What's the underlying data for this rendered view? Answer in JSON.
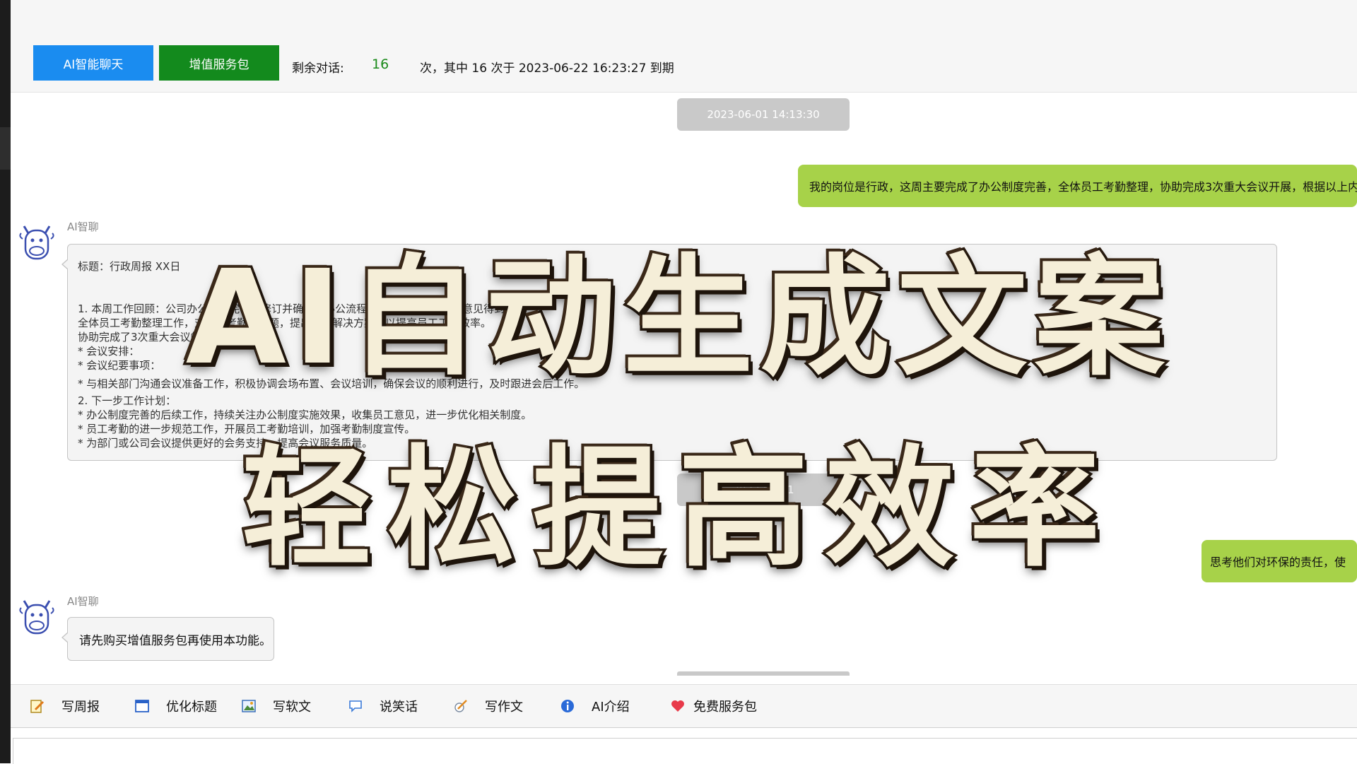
{
  "topbar": {
    "ai_chat_button": "AI智能聊天",
    "vip_button": "增值服务包",
    "remain_label": "剩余对话:",
    "remain_count": "16",
    "remain_detail": "次，其中 16 次于 2023-06-22 16:23:27 到期"
  },
  "chat": {
    "timestamp_1": "2023-06-01 14:13:30",
    "user_message_1": "我的岗位是行政，这周主要完成了办公制度完善，全体员工考勤整理，协助完成3次重大会议开展，根据以上内",
    "ai_name": "AI智聊",
    "ai_reply_1": {
      "lines": [
        "标题：行政周报 XX日",
        "1. 本周工作回顾：公司办公制度完善，修订并确定了办公流程，完成情况以及员工意见得到了，",
        "  全体员工考勤整理工作，对员工考勤的问题，提出相应解决方案，以提高员工工作效率。",
        "  协助完成了3次重大会议的筹备及会务工作。",
        "* 会议安排：",
        "* 会议纪要事项：",
        "* 与相关部门沟通会议准备工作，积极协调会场布置、会议培训，确保会议的顺利进行，及时跟进会后工作。",
        "2. 下一步工作计划：",
        "* 办公制度完善的后续工作，持续关注办公制度实施效果，收集员工意见，进一步优化相关制度。",
        "* 员工考勤的进一步规范工作，开展员工考勤培训，加强考勤制度宣传。",
        "* 为部门或公司会议提供更好的会务支持，提高会议服务质量。"
      ]
    },
    "timestamp_2": "2023-06-01",
    "user_message_2": "思考他们对环保的责任，使",
    "ai_reply_2": "请先购买增值服务包再使用本功能。"
  },
  "toolbar": {
    "items": [
      {
        "label": "写周报",
        "icon": "notepad-pencil-icon"
      },
      {
        "label": "优化标题",
        "icon": "window-icon"
      },
      {
        "label": "写软文",
        "icon": "picture-icon"
      },
      {
        "label": "说笑话",
        "icon": "speech-bubble-icon"
      },
      {
        "label": "写作文",
        "icon": "quill-icon"
      },
      {
        "label": "AI介绍",
        "icon": "info-icon"
      },
      {
        "label": "免费服务包",
        "icon": "heart-icon"
      }
    ]
  },
  "overlay": {
    "line1": "AI自动生成文案",
    "line2": "轻松提高效率"
  },
  "colors": {
    "ai_button": "#1a8cf0",
    "vip_button": "#138a1d",
    "user_bubble": "#a7d249",
    "remain_count": "#1a8a1a",
    "overlay_fill": "#f5eed8",
    "overlay_stroke": "#2a1c10"
  }
}
